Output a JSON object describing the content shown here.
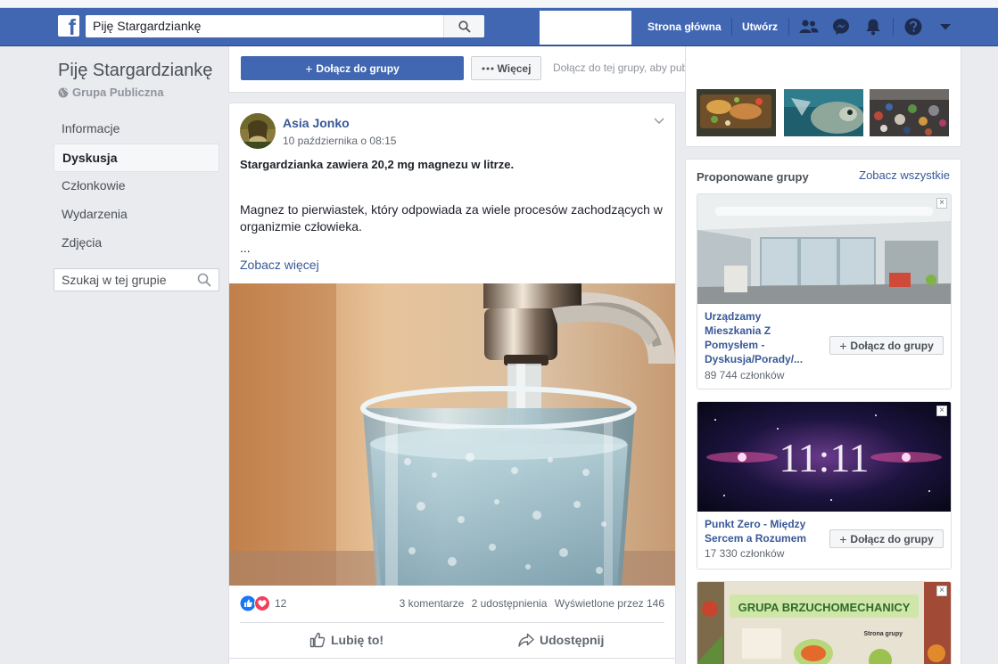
{
  "topbar": {
    "logo": "f",
    "search_value": "Piję Stargardziankę",
    "nav": [
      "Strona główna",
      "Utwórz"
    ],
    "icons": [
      "friends-icon",
      "messenger-icon",
      "notifications-icon",
      "help-icon",
      "dropdown-icon"
    ]
  },
  "group": {
    "name": "Piję Stargardziankę",
    "privacy": "Grupa Publiczna",
    "menu": [
      "Informacje",
      "Dyskusja",
      "Członkowie",
      "Wydarzenia",
      "Zdjęcia"
    ],
    "active_menu": "Dyskusja",
    "search_placeholder": "Szukaj w tej grupie"
  },
  "actions": {
    "join_label": "Dołącz do grupy",
    "more_label": "Więcej",
    "hint": "Dołącz do tej grupy, aby publikować posty i komentować."
  },
  "post": {
    "author": "Asia Jonko",
    "time": "10 października o 08:15",
    "headline": "Stargardzianka zawiera 20,2 mg magnezu w litrze.",
    "body": "Magnez to pierwiastek, który odpowiada za wiele procesów zachodzących w organizmie człowieka.",
    "ellipsis": "...",
    "see_more": "Zobacz więcej",
    "reaction_count": "12",
    "comments": "3 komentarze",
    "shares": "2 udostępnienia",
    "views": "Wyświetlone przez 146",
    "like_label": "Lubię to!",
    "share_label": "Udostępnij"
  },
  "suggestions": {
    "title": "Proponowane grupy",
    "see_all": "Zobacz wszystkie",
    "groups": [
      {
        "name": "Urządzamy Mieszkania Z Pomysłem - Dyskusja/Porady/...",
        "members": "89 744 członków",
        "join_label": "Dołącz do grupy"
      },
      {
        "name": "Punkt Zero - Między Sercem a Rozumem",
        "members": "17 330 członków",
        "join_label": "Dołącz do grupy",
        "image_text": "11:11"
      },
      {
        "image_text": "GRUPA BRZUCHOMECHANICY",
        "image_subtext": "Strona grupy"
      }
    ]
  },
  "colors": {
    "fb_blue": "#4267b2",
    "link": "#385898",
    "page_bg": "#e9ebee"
  }
}
